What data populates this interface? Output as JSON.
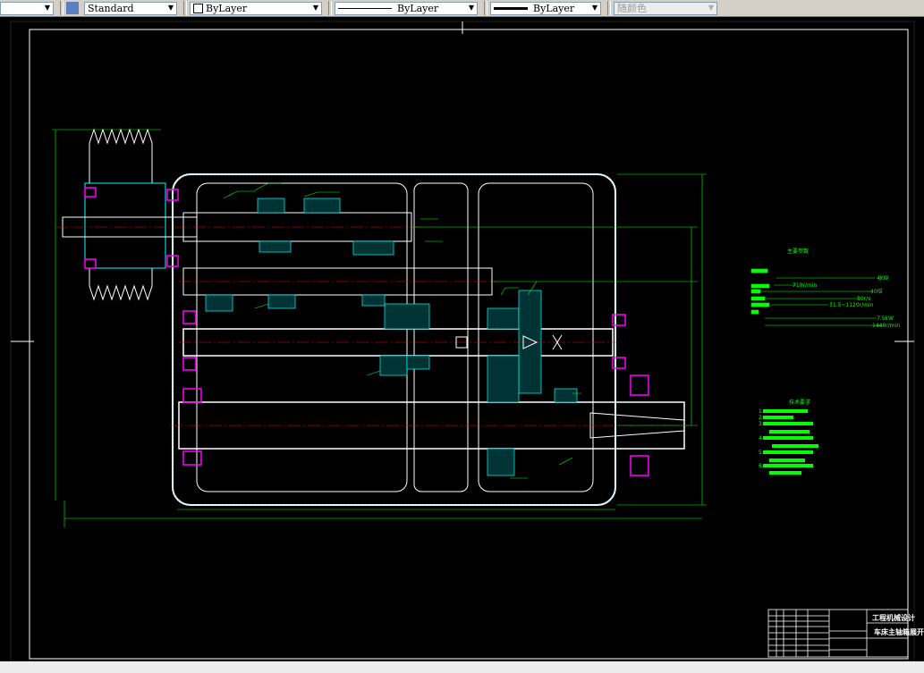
{
  "toolbar": {
    "text_style": "Standard",
    "layer_color": "ByLayer",
    "linetype": "ByLayer",
    "lineweight": "ByLayer",
    "plot_style": "随颜色"
  },
  "drawing": {
    "colors": {
      "background": "#000000",
      "outline": "#ffffff",
      "dimension": "#00ff00",
      "centerline": "#ff0000",
      "hatch": "#00ffff",
      "bearing": "#ff00ff"
    },
    "spec_table_title": "主要参数",
    "spec_values": [
      "4KW",
      "710r/min",
      "40倍",
      "80r/s",
      "31.5~1120r/min",
      "7.5kW",
      "1440r/min"
    ],
    "tech_requirements_title": "技术要求",
    "tech_requirements_lines": [
      "1.",
      "2.",
      "3.",
      "4.",
      "5.",
      "6."
    ],
    "title_block": {
      "line1": "工程机械设计",
      "line2": "车床主轴箱展开图"
    }
  }
}
